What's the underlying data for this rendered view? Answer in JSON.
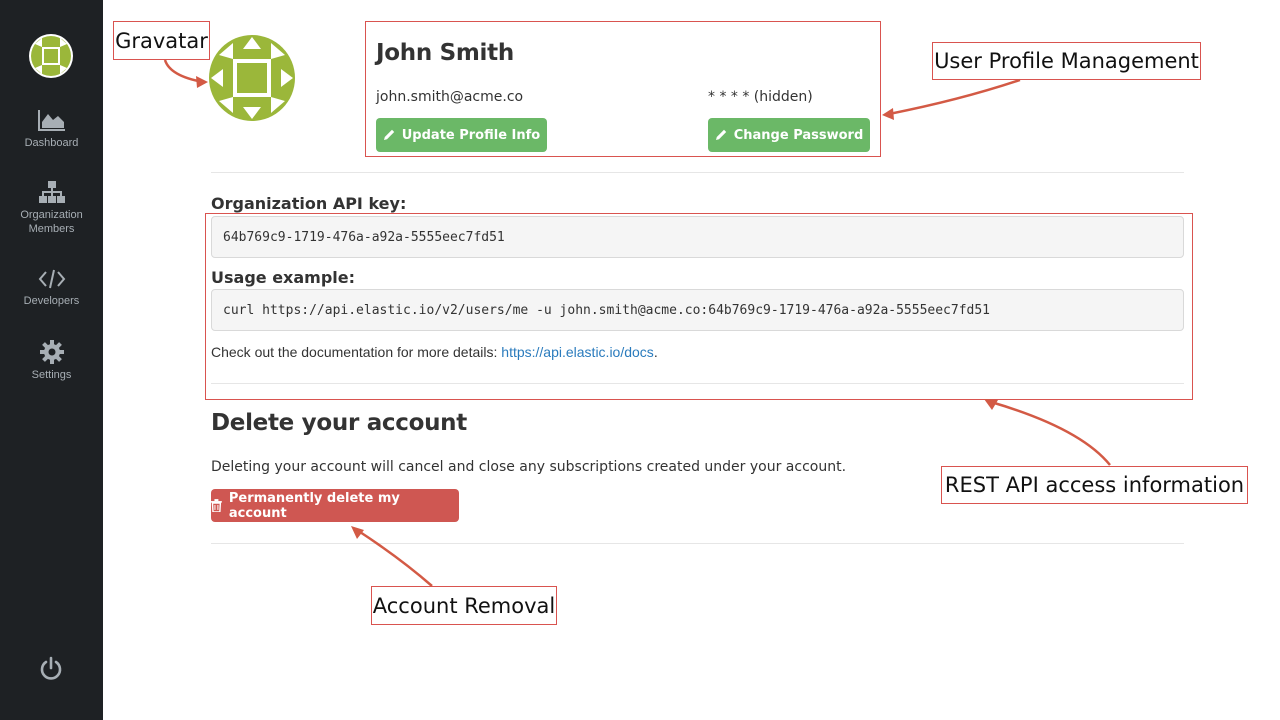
{
  "sidebar": {
    "items": [
      {
        "icon": "area-chart-icon",
        "label": "Dashboard"
      },
      {
        "icon": "sitemap-icon",
        "label": "Organization Members"
      },
      {
        "icon": "code-icon",
        "label": "Developers"
      },
      {
        "icon": "gear-icon",
        "label": "Settings"
      }
    ],
    "power_icon": "power-icon"
  },
  "colors": {
    "sidebar_bg": "#1e2124",
    "accent_green": "#6bb867",
    "danger_red": "#cf5752",
    "link_blue": "#2a7bbd",
    "annotation_red": "#d9534f",
    "gravatar_green": "#9bb73a"
  },
  "profile": {
    "name": "John Smith",
    "email": "john.smith@acme.co",
    "password_display": "* * * * (hidden)",
    "update_button": "Update Profile Info",
    "change_password_button": "Change Password"
  },
  "api": {
    "key_heading": "Organization API key:",
    "key_value": "64b769c9-1719-476a-a92a-5555eec7fd51",
    "usage_heading": "Usage example:",
    "usage_value": "curl https://api.elastic.io/v2/users/me -u john.smith@acme.co:64b769c9-1719-476a-a92a-5555eec7fd51",
    "docs_text": "Check out the documentation for more details: ",
    "docs_link": "https://api.elastic.io/docs",
    "docs_period": "."
  },
  "delete": {
    "heading": "Delete your account",
    "description": "Deleting your account will cancel and close any subscriptions created under your account.",
    "button": "Permanently delete my account"
  },
  "annotations": {
    "gravatar": "Gravatar",
    "profile": "User Profile Management",
    "api": "REST API access information",
    "removal": "Account Removal"
  }
}
